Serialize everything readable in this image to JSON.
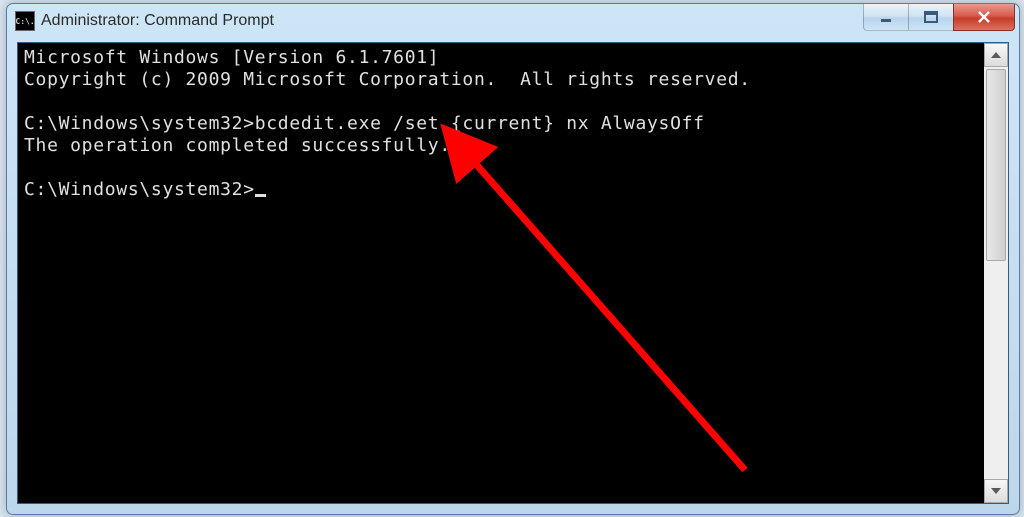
{
  "window": {
    "title": "Administrator: Command Prompt",
    "icon_text": "C:\\."
  },
  "console": {
    "lines": [
      "Microsoft Windows [Version 6.1.7601]",
      "Copyright (c) 2009 Microsoft Corporation.  All rights reserved.",
      "",
      "C:\\Windows\\system32>bcdedit.exe /set {current} nx AlwaysOff",
      "The operation completed successfully.",
      "",
      "C:\\Windows\\system32>"
    ]
  },
  "annotation": {
    "arrow_color": "#ff0000"
  }
}
